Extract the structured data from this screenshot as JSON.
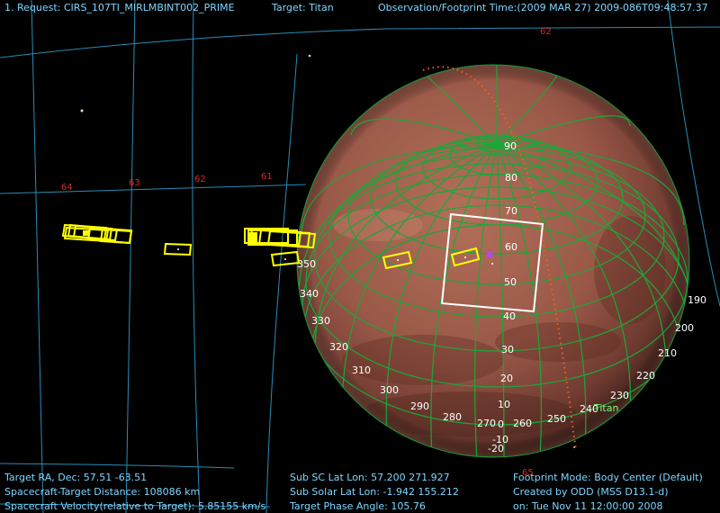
{
  "header": {
    "request": "1. Request: CIRS_107TI_MIRLMBINT002_PRIME",
    "target": "Target: Titan",
    "obs_time": "Observation/Footprint Time:(2009 MAR 27) 2009-086T09:48:57.37"
  },
  "footer": {
    "ra_dec": "Target RA, Dec: 57.51   -63.51",
    "distance": "Spacecraft-Target Distance:  108086 km",
    "velocity": "Spacecraft Velocity(relative to Target): 5.85155 km/s",
    "sub_sc": "Sub SC Lat Lon: 57.200  271.927",
    "sub_solar": "Sub Solar Lat Lon: -1.942  155.212",
    "phase": "Target Phase Angle: 105.76",
    "footprint_mode": "Footprint Mode: Body Center (Default)",
    "created_by": "Created by ODD (MSS D13.1-d)",
    "created_on": "on: Tue Nov 11 12:00:00 2008"
  },
  "sky_grid_labels": {
    "l64": "64",
    "l63": "63",
    "l62": "62",
    "l61": "61",
    "top62": "62",
    "bottom65": "65"
  },
  "lat_labels": {
    "l90": "90",
    "l80": "80",
    "l70": "70",
    "l60": "60",
    "l50": "50",
    "l40": "40",
    "l30": "30",
    "l20": "20",
    "l10": "10",
    "l0": "0",
    "lm10": "-10",
    "lm20": "-20"
  },
  "lon_labels": {
    "l350": "350",
    "l340": "340",
    "l330": "330",
    "l320": "320",
    "l310": "310",
    "l300": "300",
    "l290": "290",
    "l280": "280",
    "l270": "270",
    "l260": "260",
    "l250": "250",
    "l240": "240",
    "l230": "230",
    "l220": "220",
    "l210": "210",
    "l200": "200",
    "l190": "190"
  },
  "body_label": "Titan",
  "colors": {
    "hud_text": "#7fd6ff",
    "sky_grid": "#2fa6d8",
    "planet_grid": "#1aa83a",
    "footprint": "#ffff00",
    "track": "#ff5a1e",
    "fov": "#ffffff",
    "marker": "#c040ff"
  }
}
